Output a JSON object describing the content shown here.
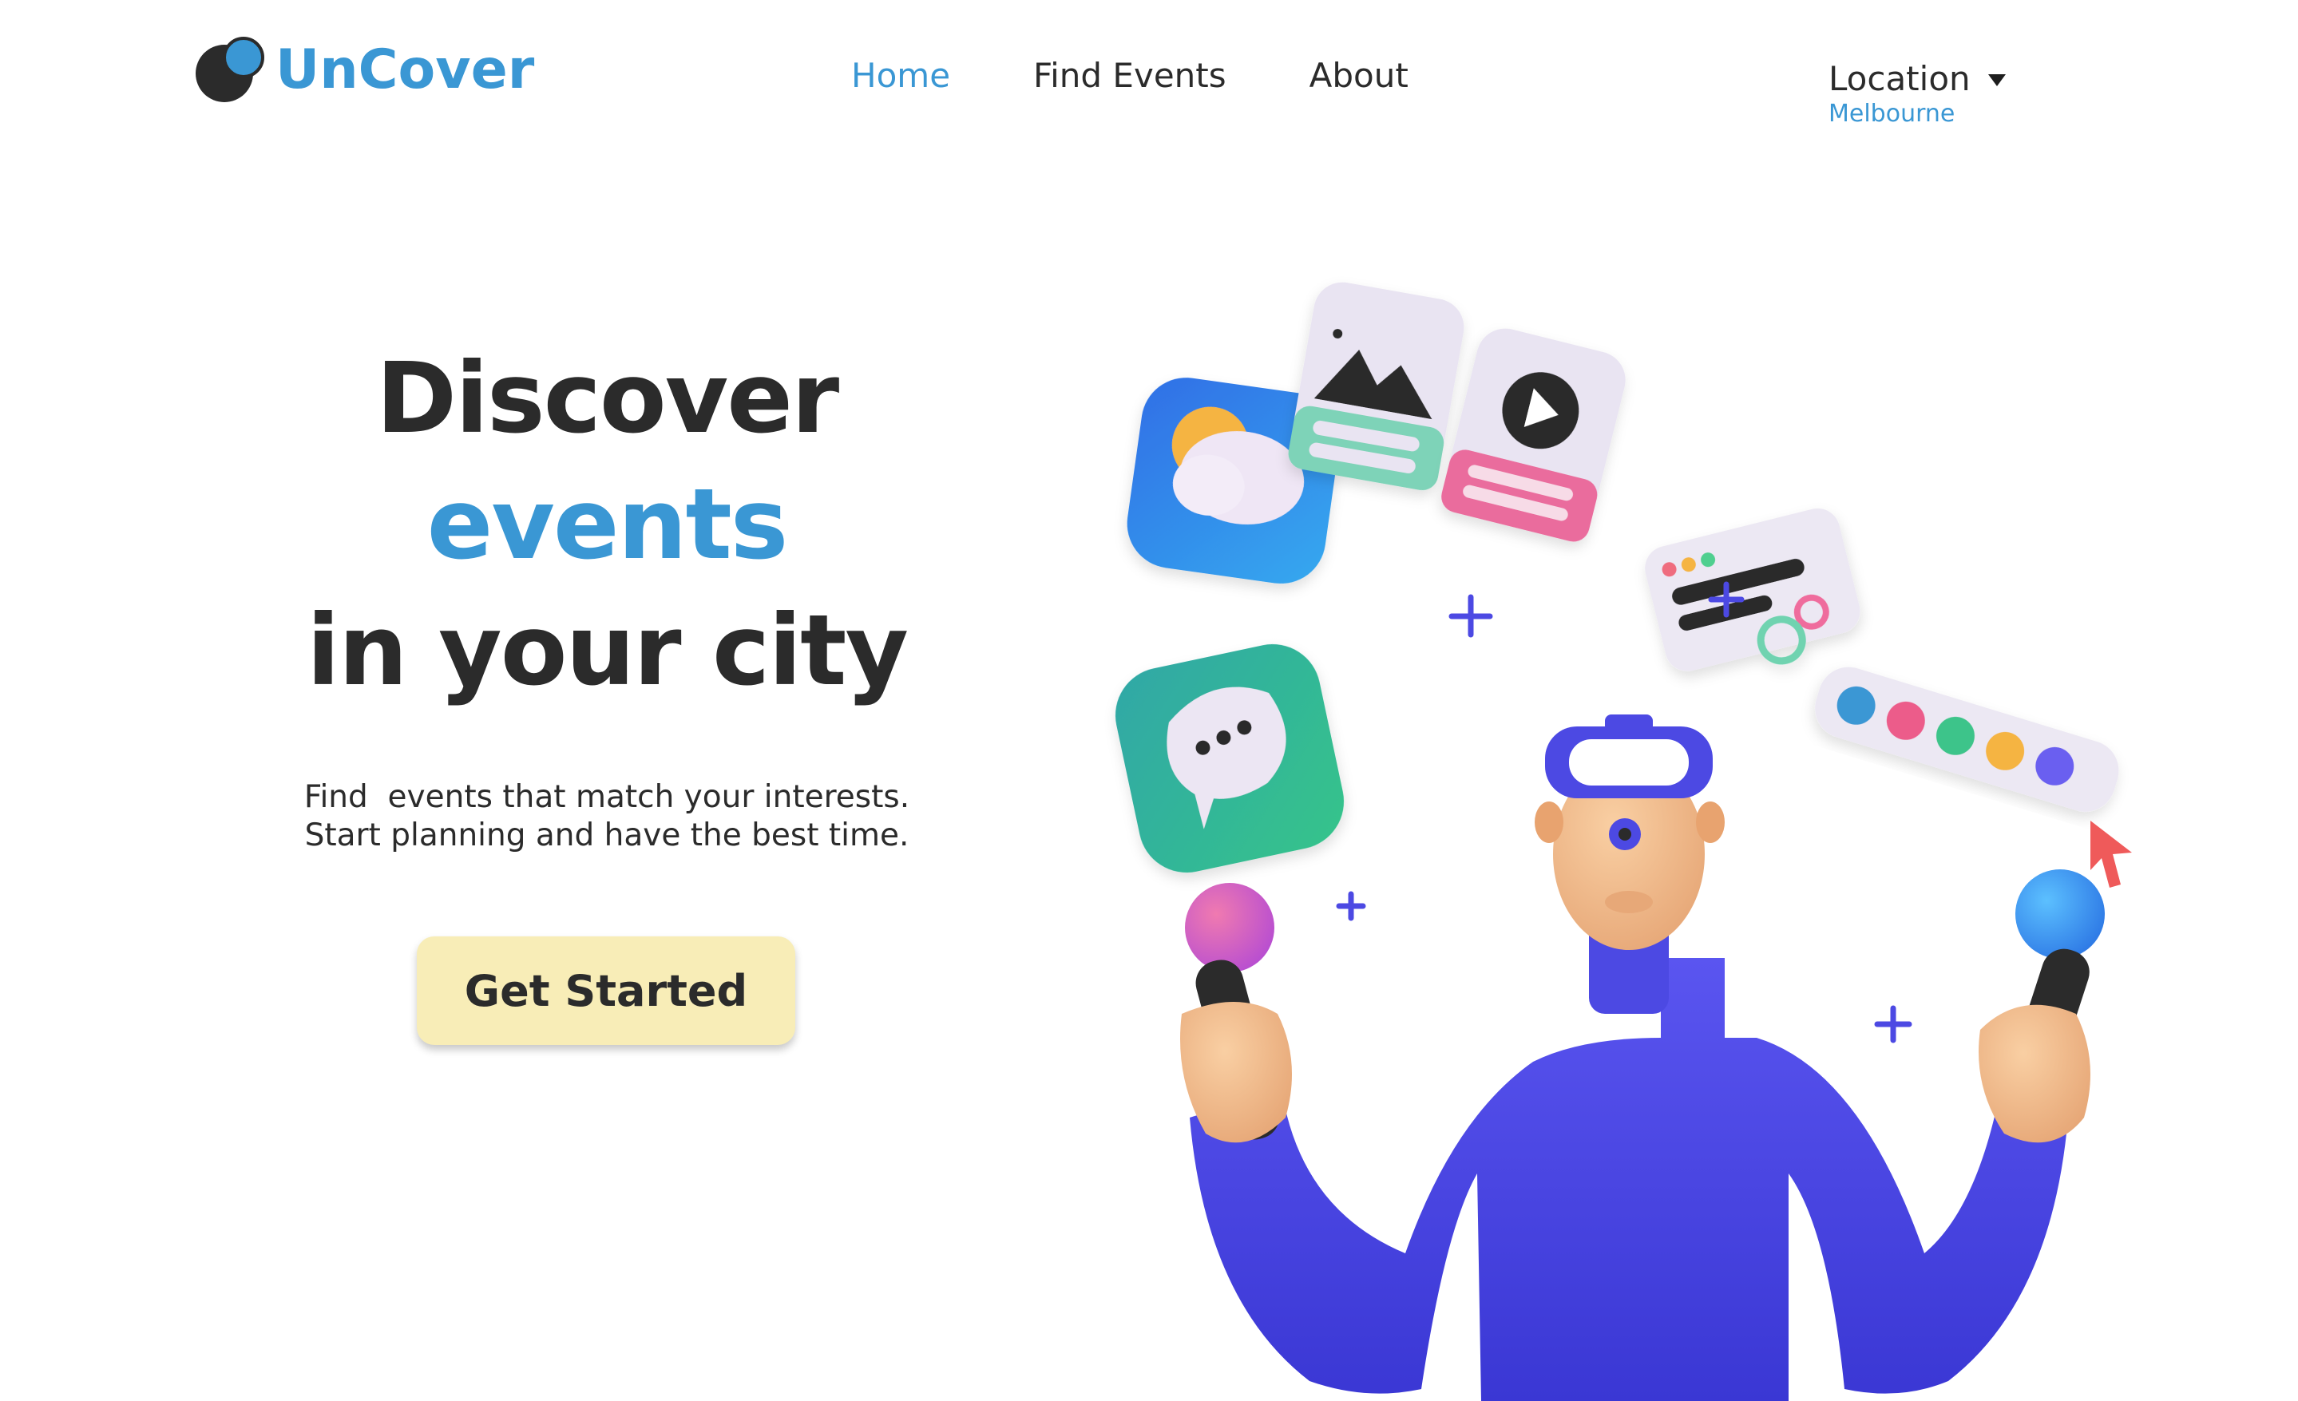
{
  "brand": {
    "name": "UnCover",
    "accent_color": "#3a97d4",
    "text_color": "#2b2b2b"
  },
  "nav": {
    "items": [
      {
        "label": "Home",
        "active": true
      },
      {
        "label": "Find Events",
        "active": false
      },
      {
        "label": "About",
        "active": false
      }
    ]
  },
  "location": {
    "label": "Location",
    "value": "Melbourne",
    "icon": "caret-down-icon"
  },
  "hero": {
    "line1": "Discover",
    "line2": "events",
    "line3": "in your city",
    "sub1": "Find  events that match your interests.",
    "sub2": "Start planning and have the best time.",
    "cta_label": "Get Started",
    "cta_color": "#f8edb7"
  },
  "illustration": {
    "subject": "person-with-vr-headset-and-controllers",
    "icons": [
      "weather-app-icon",
      "image-card-icon",
      "video-card-icon",
      "chat-app-icon",
      "browser-window-icon",
      "color-palette-icon",
      "cursor-icon",
      "plus-icon"
    ],
    "figure_color": "#4c49e3"
  }
}
